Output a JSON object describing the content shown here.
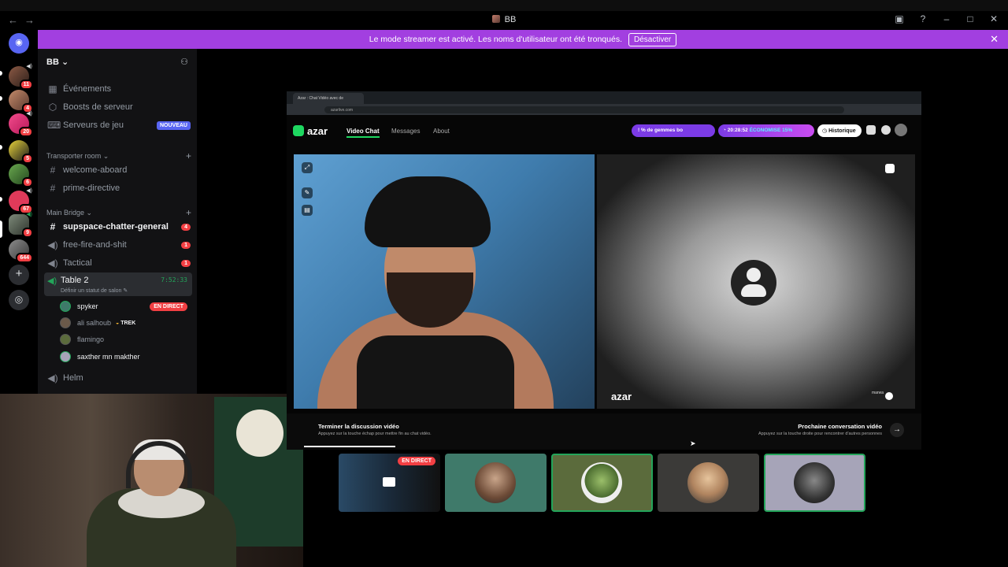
{
  "window": {
    "title": "BB",
    "nav_icons": [
      "arrow-left-icon",
      "arrow-right-icon"
    ],
    "controls": [
      "screen-share-icon",
      "help-icon",
      "minimize-icon",
      "maximize-icon",
      "close-icon"
    ]
  },
  "banner": {
    "message": "Le mode streamer est activé. Les noms d'utilisateur ont été tronqués.",
    "button_label": "Désactiver",
    "color": "#a23fe0"
  },
  "server_list": {
    "badges": [
      "11",
      "4",
      "20",
      "5",
      "6",
      "67",
      "9",
      "644"
    ],
    "home_icon": "discord-logo-icon",
    "add_icon": "plus-icon",
    "explore_icon": "compass-icon"
  },
  "server": {
    "name": "BB",
    "invite_icon": "add-user-icon"
  },
  "sidebar": {
    "top_items": [
      {
        "label": "Événements",
        "icon": "calendar-icon"
      },
      {
        "label": "Boosts de serveur",
        "icon": "boost-icon"
      },
      {
        "label": "Serveurs de jeu",
        "icon": "controller-icon",
        "badge": "NOUVEAU"
      }
    ],
    "categories": [
      {
        "name": "Transporter room"
      },
      {
        "name": "Main Bridge"
      }
    ],
    "channels": [
      {
        "name": "welcome-aboard",
        "type": "text"
      },
      {
        "name": "prime-directive",
        "type": "text"
      },
      {
        "name": "supspace-chatter-general",
        "type": "text",
        "badge": "4"
      },
      {
        "name": "free-fire-and-shit",
        "type": "voice",
        "badge": "1"
      },
      {
        "name": "Tactical",
        "type": "voice",
        "badge": "1"
      },
      {
        "name": "Helm",
        "type": "voice"
      }
    ],
    "active_voice": {
      "name": "Table 2",
      "timer": "7:52:33",
      "status_placeholder": "Définir un statut de salon",
      "users": [
        {
          "name": "spyker",
          "badge": "EN DIRECT"
        },
        {
          "name": "ali salhoub",
          "tag": "TREK"
        },
        {
          "name": "flamingo"
        },
        {
          "name": "saxther mn makther"
        }
      ]
    }
  },
  "stream": {
    "browser_tab": "Azar : Chat Vidéo avec de",
    "url": "azarlive.com",
    "azar": {
      "logo": "azar",
      "nav": [
        "Video Chat",
        "Messages",
        "About"
      ],
      "gems_pill": "! % de gemmes bo",
      "timer_pill": "20:28:52",
      "timer_pill_promo": "ÉCONOMISE 15%",
      "history_button": "Historique",
      "footer_left_title": "Terminer la discussion vidéo",
      "footer_left_sub": "Appuyez sur la touche échap pour mettre fin au chat vidéo.",
      "footer_right_title": "Prochaine conversation vidéo",
      "footer_right_sub": "Appuyez sur la touche droite pour rencontrer d'autres personnes",
      "remote_user": "marwa",
      "accent": "#1ed760"
    }
  },
  "tiles": [
    {
      "label": "EN DIRECT",
      "kind": "stream"
    },
    {
      "kind": "avatar",
      "color": "#3f7a6a"
    },
    {
      "kind": "avatar",
      "color": "#5b6b3c",
      "speaking": true
    },
    {
      "kind": "avatar",
      "color": "#3b3a38"
    },
    {
      "kind": "avatar",
      "color": "#a6a4b8",
      "speaking": true
    }
  ]
}
